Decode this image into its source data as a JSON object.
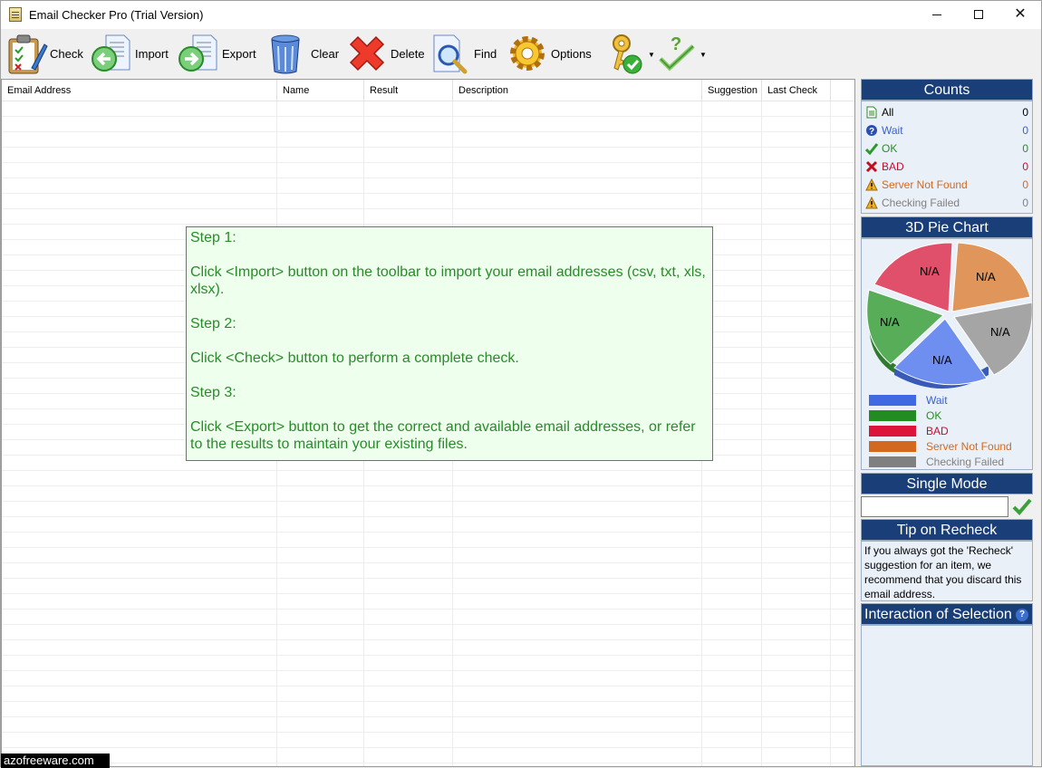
{
  "window": {
    "title": "Email Checker Pro (Trial Version)"
  },
  "toolbar": {
    "check": "Check",
    "import": "Import",
    "export": "Export",
    "clear": "Clear",
    "delete": "Delete",
    "find": "Find",
    "options": "Options"
  },
  "grid": {
    "columns": [
      "Email Address",
      "Name",
      "Result",
      "Description",
      "Suggestion",
      "Last Check"
    ],
    "rows": []
  },
  "steps": {
    "step1_title": "Step 1:",
    "step1_text": "Click <Import> button on the toolbar to import your email addresses (csv, txt, xls, xlsx).",
    "step2_title": "Step 2:",
    "step2_text": "Click <Check> button to perform a complete check.",
    "step3_title": "Step 3:",
    "step3_text": "Click <Export> button to get the correct and available email addresses, or refer to the results to maintain your existing files."
  },
  "counts": {
    "header": "Counts",
    "items": [
      {
        "label": "All",
        "value": "0",
        "color": "#000000",
        "icon": "document-icon"
      },
      {
        "label": "Wait",
        "value": "0",
        "color": "#3a5fd0",
        "icon": "question-icon"
      },
      {
        "label": "OK",
        "value": "0",
        "color": "#2a8a2a",
        "icon": "check-icon"
      },
      {
        "label": "BAD",
        "value": "0",
        "color": "#c01030",
        "icon": "cross-icon"
      },
      {
        "label": "Server Not Found",
        "value": "0",
        "color": "#d06a20",
        "icon": "warning-icon"
      },
      {
        "label": "Checking Failed",
        "value": "0",
        "color": "#808080",
        "icon": "warning-icon"
      }
    ]
  },
  "pie": {
    "header": "3D Pie Chart",
    "slices": [
      {
        "label": "N/A",
        "color": "#e0506a"
      },
      {
        "label": "N/A",
        "color": "#e09050"
      },
      {
        "label": "N/A",
        "color": "#a0a0a0"
      },
      {
        "label": "N/A",
        "color": "#6a8ae8"
      },
      {
        "label": "N/A",
        "color": "#55aa55"
      }
    ],
    "legend": [
      {
        "label": "Wait",
        "color": "#4169e1",
        "text_color": "#3a5fd0"
      },
      {
        "label": "OK",
        "color": "#228b22",
        "text_color": "#2a8a2a"
      },
      {
        "label": "BAD",
        "color": "#dc143c",
        "text_color": "#c01030"
      },
      {
        "label": "Server Not Found",
        "color": "#d2691e",
        "text_color": "#d06a20"
      },
      {
        "label": "Checking Failed",
        "color": "#808080",
        "text_color": "#808080"
      }
    ]
  },
  "single_mode": {
    "header": "Single Mode",
    "value": ""
  },
  "tip": {
    "header": "Tip on Recheck",
    "text": "If you always got the 'Recheck' suggestion for an item, we recommend that you discard this email address."
  },
  "interaction": {
    "header": "Interaction of Selection",
    "help": "?"
  },
  "watermark": "azofreeware.com"
}
